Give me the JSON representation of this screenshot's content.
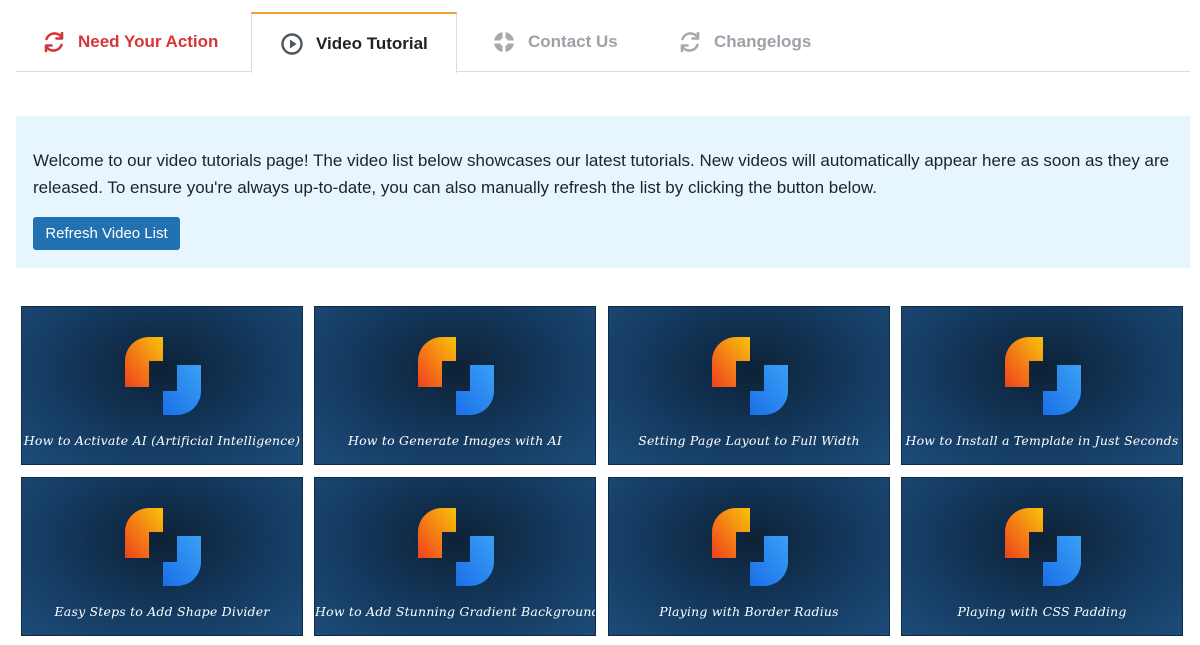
{
  "tabs": [
    {
      "label": "Need Your Action",
      "icon": "refresh-icon",
      "color": "#d63638"
    },
    {
      "label": "Video Tutorial",
      "icon": "play-circle-icon",
      "active": true
    },
    {
      "label": "Contact Us",
      "icon": "lifebuoy-icon"
    },
    {
      "label": "Changelogs",
      "icon": "refresh-icon"
    }
  ],
  "notice": {
    "text": "Welcome to our video tutorials page! The video list below showcases our latest tutorials. New videos will automatically appear here as soon as they are released. To ensure you're always up-to-date, you can also manually refresh the list by clicking the button below.",
    "button_label": "Refresh Video List"
  },
  "videos": [
    {
      "title": "How to Activate AI (Artificial Intelligence)"
    },
    {
      "title": "How to Generate Images with AI"
    },
    {
      "title": "Setting Page Layout to Full Width"
    },
    {
      "title": "How to Install a Template in Just Seconds"
    },
    {
      "title": "Easy Steps to Add Shape Divider"
    },
    {
      "title": "How to Add Stunning Gradient Backgrounds"
    },
    {
      "title": "Playing with Border Radius"
    },
    {
      "title": "Playing with CSS Padding"
    }
  ],
  "colors": {
    "accent": "#2271b1",
    "active_tab_border": "#f0a030",
    "notice_bg": "#e7f5fe",
    "thumbnail_bg": "#143a60"
  }
}
